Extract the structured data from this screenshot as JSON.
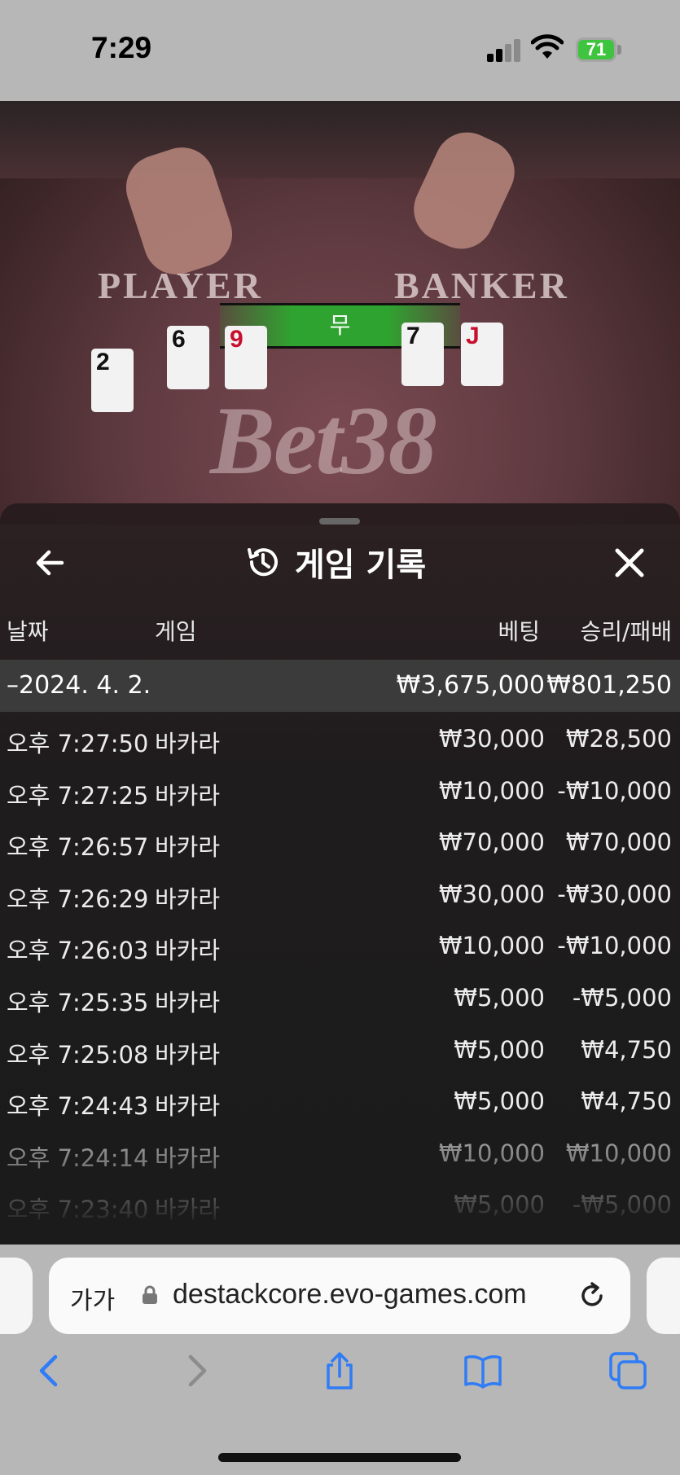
{
  "status": {
    "time": "7:29",
    "battery": "71"
  },
  "video": {
    "player_label": "PLAYER",
    "banker_label": "BANKER",
    "result_label": "무",
    "brand_mark": "Bet38",
    "cards": {
      "player": [
        "2",
        "6",
        "9"
      ],
      "banker": [
        "7",
        "J"
      ]
    }
  },
  "panel": {
    "title": "게임 기록",
    "columns": {
      "date": "날짜",
      "game": "게임",
      "bet": "베팅",
      "result": "승리/패배"
    },
    "date_group": {
      "date": "–2024. 4. 2.",
      "bet_total": "₩3,675,000",
      "result_total": "₩801,250"
    },
    "rows": [
      {
        "time": "오후 7:27:50",
        "game": "바카라",
        "bet": "₩30,000",
        "result": "₩28,500"
      },
      {
        "time": "오후 7:27:25",
        "game": "바카라",
        "bet": "₩10,000",
        "result": "-₩10,000"
      },
      {
        "time": "오후 7:26:57",
        "game": "바카라",
        "bet": "₩70,000",
        "result": "₩70,000"
      },
      {
        "time": "오후 7:26:29",
        "game": "바카라",
        "bet": "₩30,000",
        "result": "-₩30,000"
      },
      {
        "time": "오후 7:26:03",
        "game": "바카라",
        "bet": "₩10,000",
        "result": "-₩10,000"
      },
      {
        "time": "오후 7:25:35",
        "game": "바카라",
        "bet": "₩5,000",
        "result": "-₩5,000"
      },
      {
        "time": "오후 7:25:08",
        "game": "바카라",
        "bet": "₩5,000",
        "result": "₩4,750"
      },
      {
        "time": "오후 7:24:43",
        "game": "바카라",
        "bet": "₩5,000",
        "result": "₩4,750"
      },
      {
        "time": "오후 7:24:14",
        "game": "바카라",
        "bet": "₩10,000",
        "result": "₩10,000"
      },
      {
        "time": "오후 7:23:40",
        "game": "바카라",
        "bet": "₩5,000",
        "result": "-₩5,000"
      }
    ]
  },
  "browser": {
    "text_size_label": "가가",
    "url": "destackcore.evo-games.com"
  },
  "colors": {
    "result_green": "#2fa32f",
    "ios_blue": "#2f7cf6",
    "battery_green": "#3ec43e"
  }
}
